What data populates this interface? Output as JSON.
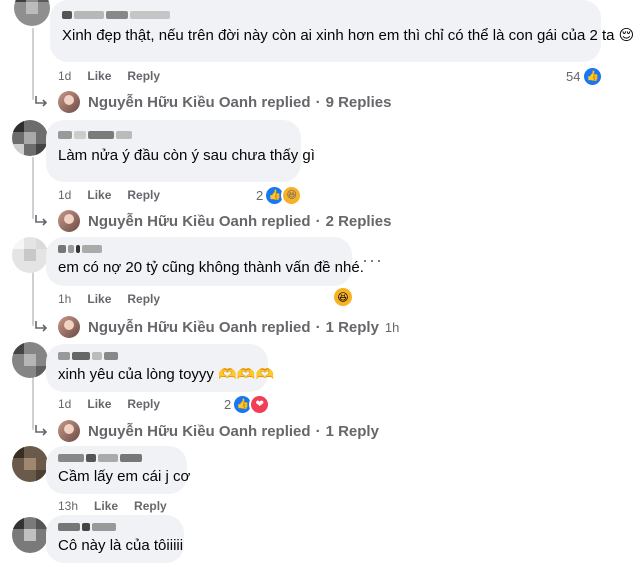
{
  "comments": [
    {
      "text": "Xinh đẹp thật, nếu trên đời này còn ai xinh hơn em thì chỉ có thể là con gái của 2 ta 😌",
      "time": "1d",
      "like": "Like",
      "reply": "Reply",
      "reaction_count": "54",
      "reply_summary": {
        "name": "Nguyễn Hữu Kiều Oanh replied",
        "dot": "·",
        "count": "9 Replies",
        "time": ""
      }
    },
    {
      "text": "Làm nửa ý đầu còn ý sau chưa thấy gì",
      "time": "1d",
      "like": "Like",
      "reply": "Reply",
      "reaction_count": "2",
      "reply_summary": {
        "name": "Nguyễn Hữu Kiều Oanh replied",
        "dot": "·",
        "count": "2 Replies",
        "time": ""
      }
    },
    {
      "text": "em có nợ 20 tỷ cũng không thành vấn đề nhé.",
      "time": "1h",
      "like": "Like",
      "reply": "Reply",
      "reaction_count": "",
      "reply_summary": {
        "name": "Nguyễn Hữu Kiều Oanh replied",
        "dot": "·",
        "count": "1 Reply",
        "time": "1h"
      }
    },
    {
      "text": "xinh yêu của lòng toyyy 🫶🫶🫶",
      "time": "1d",
      "like": "Like",
      "reply": "Reply",
      "reaction_count": "2",
      "reply_summary": {
        "name": "Nguyễn Hữu Kiều Oanh replied",
        "dot": "·",
        "count": "1 Reply",
        "time": ""
      }
    },
    {
      "text": "Cầm lấy em cái j cơ",
      "time": "13h",
      "like": "Like",
      "reply": "Reply",
      "reaction_count": ""
    },
    {
      "text": "Cô này là của tôiiiii",
      "time": "",
      "like": "",
      "reply": "",
      "reaction_count": ""
    }
  ],
  "more_options": "···",
  "colors": {
    "bubble": "#f0f2f5",
    "meta": "#65676b",
    "like": "#1877f2",
    "haha": "#f7b125",
    "love": "#f33e58"
  }
}
